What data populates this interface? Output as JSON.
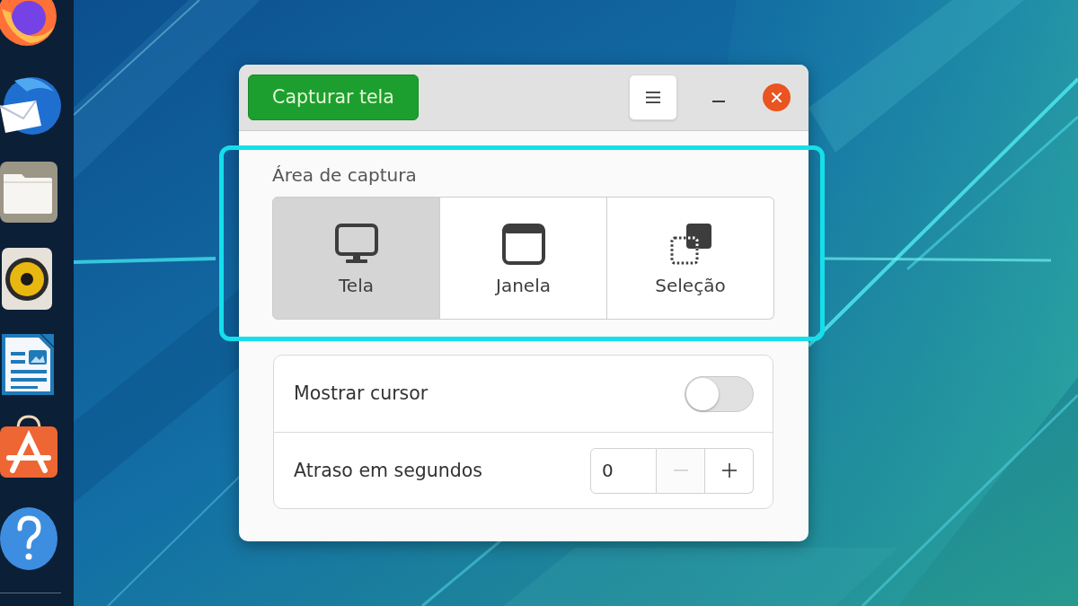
{
  "window": {
    "header": {
      "capture_button": "Capturar tela"
    },
    "capture_area": {
      "label": "Área de captura",
      "highlighted": true,
      "options": [
        {
          "kind": "screen",
          "label": "Tela",
          "selected": true
        },
        {
          "kind": "window",
          "label": "Janela",
          "selected": false
        },
        {
          "kind": "selection",
          "label": "Seleção",
          "selected": false
        }
      ]
    },
    "settings": [
      {
        "kind": "switch",
        "label": "Mostrar cursor",
        "on": false
      },
      {
        "kind": "spin",
        "label": "Atraso em segundos",
        "value": "0",
        "buttons": [
          {
            "kind": "decrease",
            "disabled": true
          },
          {
            "kind": "increase",
            "disabled": false
          }
        ]
      }
    ]
  }
}
